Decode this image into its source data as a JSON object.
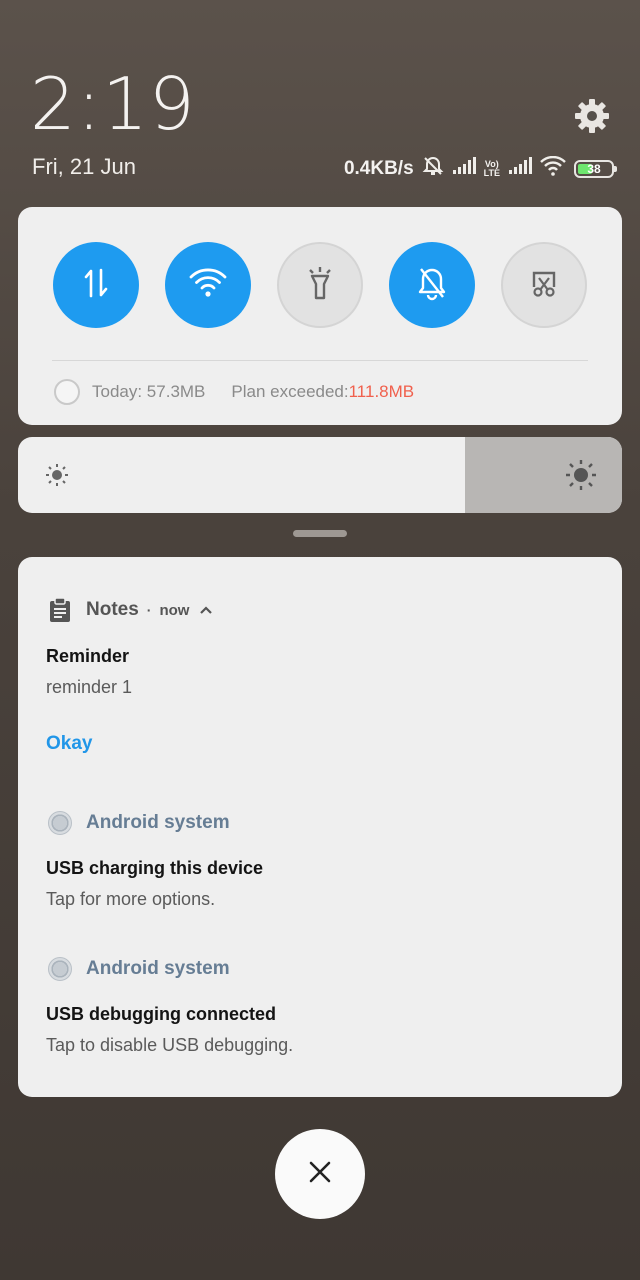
{
  "status": {
    "time": "2:19",
    "date": "Fri, 21 Jun",
    "speed": "0.4KB/s",
    "volte": "Vo\nLTE",
    "battery": "38"
  },
  "quick_settings": {
    "toggles": [
      {
        "name": "mobile-data",
        "icon": "data-arrows-icon",
        "state": "on"
      },
      {
        "name": "wifi",
        "icon": "wifi-icon",
        "state": "on"
      },
      {
        "name": "flashlight",
        "icon": "flashlight-icon",
        "state": "off"
      },
      {
        "name": "silent",
        "icon": "bell-off-icon",
        "state": "on"
      },
      {
        "name": "screenshot",
        "icon": "scissors-screen-icon",
        "state": "off"
      }
    ],
    "today_usage": "Today: 57.3MB",
    "plan_label": "Plan exceeded: ",
    "plan_value": "111.8MB"
  },
  "brightness": {
    "level": 0.74
  },
  "notifications": {
    "notes": {
      "app": "Notes",
      "time": "now",
      "title": "Reminder",
      "text": "reminder 1",
      "action": "Okay"
    },
    "system1": {
      "app": "Android system",
      "title": "USB charging this device",
      "text": "Tap for more options."
    },
    "system2": {
      "app": "Android system",
      "title": "USB debugging connected",
      "text": "Tap to disable USB debugging."
    }
  },
  "colors": {
    "accent": "#1e9bf0",
    "plan_exceeded": "#f0604d",
    "link": "#2196e8"
  }
}
